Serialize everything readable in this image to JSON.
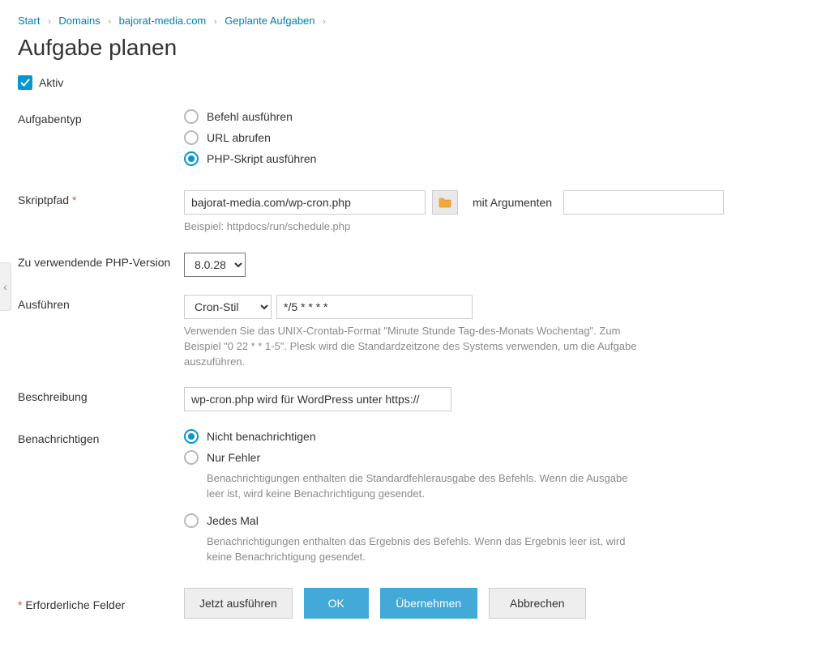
{
  "breadcrumb": {
    "items": [
      "Start",
      "Domains",
      "bajorat-media.com",
      "Geplante Aufgaben"
    ]
  },
  "page_title": "Aufgabe planen",
  "active": {
    "label": "Aktiv",
    "checked": true
  },
  "task_type": {
    "label": "Aufgabentyp",
    "options": {
      "cmd": "Befehl ausführen",
      "url": "URL abrufen",
      "php": "PHP-Skript ausführen"
    },
    "selected": "php"
  },
  "script_path": {
    "label": "Skriptpfad",
    "value": "bajorat-media.com/wp-cron.php",
    "args_label": "mit Argumenten",
    "args_value": "",
    "hint": "Beispiel: httpdocs/run/schedule.php"
  },
  "php_version": {
    "label": "Zu verwendende PHP-Version",
    "value": "8.0.28"
  },
  "run": {
    "label": "Ausführen",
    "style_value": "Cron-Stil",
    "cron_value": "*/5 * * * *",
    "hint": "Verwenden Sie das UNIX-Crontab-Format \"Minute Stunde Tag-des-Monats Wochentag\". Zum Beispiel \"0 22 * * 1-5\". Plesk wird die Standardzeitzone des Systems verwenden, um die Aufgabe auszuführen."
  },
  "description": {
    "label": "Beschreibung",
    "value": "wp-cron.php wird für WordPress unter https://"
  },
  "notify": {
    "label": "Benachrichtigen",
    "options": {
      "none": {
        "label": "Nicht benachrichtigen"
      },
      "errors": {
        "label": "Nur Fehler",
        "hint": "Benachrichtigungen enthalten die Standardfehlerausgabe des Befehls. Wenn die Ausgabe leer ist, wird keine Benachrichtigung gesendet."
      },
      "always": {
        "label": "Jedes Mal",
        "hint": "Benachrichtigungen enthalten das Ergebnis des Befehls. Wenn das Ergebnis leer ist, wird keine Benachrichtigung gesendet."
      }
    },
    "selected": "none"
  },
  "required_note": "Erforderliche Felder",
  "buttons": {
    "run_now": "Jetzt ausführen",
    "ok": "OK",
    "apply": "Übernehmen",
    "cancel": "Abbrechen"
  }
}
